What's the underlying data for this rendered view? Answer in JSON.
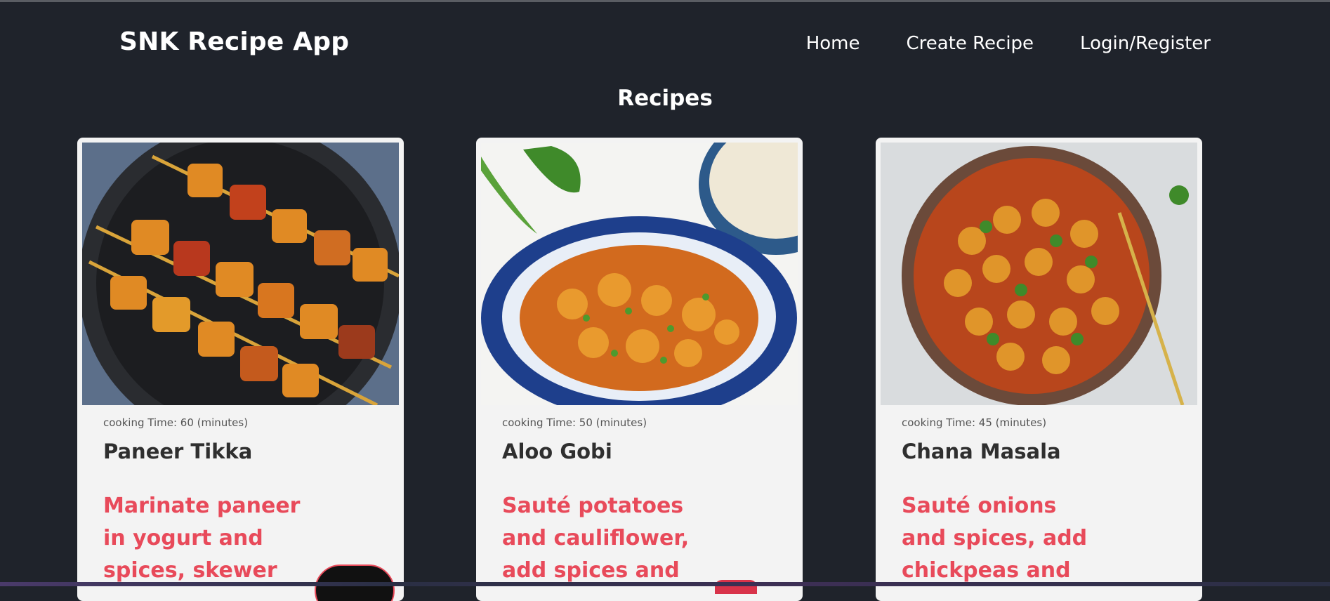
{
  "app": {
    "brand": "SNK Recipe App"
  },
  "nav": {
    "items": [
      "Home",
      "Create Recipe",
      "Login/Register"
    ]
  },
  "page": {
    "heading": "Recipes"
  },
  "recipes": [
    {
      "time": "cooking Time: 60 (minutes)",
      "name": "Paneer Tikka",
      "description": "Marinate paneer in yogurt and spices, skewer"
    },
    {
      "time": "cooking Time: 50 (minutes)",
      "name": "Aloo Gobi",
      "description": "Sauté potatoes and cauliflower, add spices and"
    },
    {
      "time": "cooking Time: 45 (minutes)",
      "name": "Chana Masala",
      "description": "Sauté onions and spices, add chickpeas and"
    }
  ],
  "colors": {
    "background": "#1f232b",
    "card": "#f3f3f3",
    "accent": "#e84a5a",
    "title": "#2f2f2f"
  }
}
